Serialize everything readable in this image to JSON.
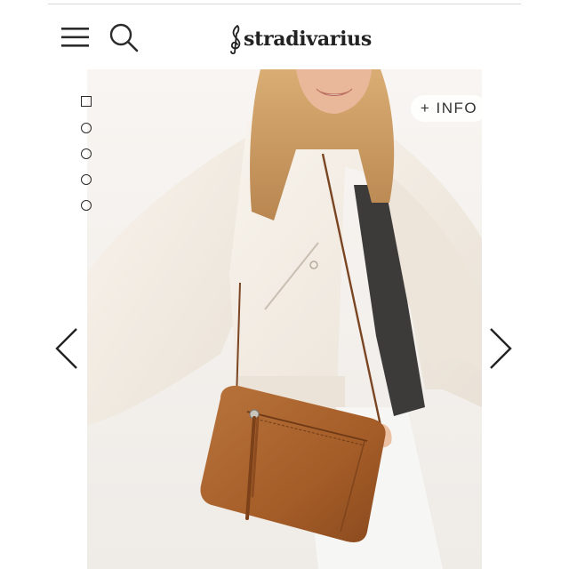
{
  "header": {
    "brand": "stradivarius",
    "menu_icon": "hamburger-menu-icon",
    "search_icon": "search-icon"
  },
  "gallery": {
    "image_count": 5,
    "active_index": 0,
    "info_label": "+ INFO",
    "prev_icon": "chevron-left-icon",
    "next_icon": "chevron-right-icon"
  },
  "colors": {
    "bag": "#a9612c",
    "jacket": "#f4eee6",
    "text": "#222222"
  }
}
